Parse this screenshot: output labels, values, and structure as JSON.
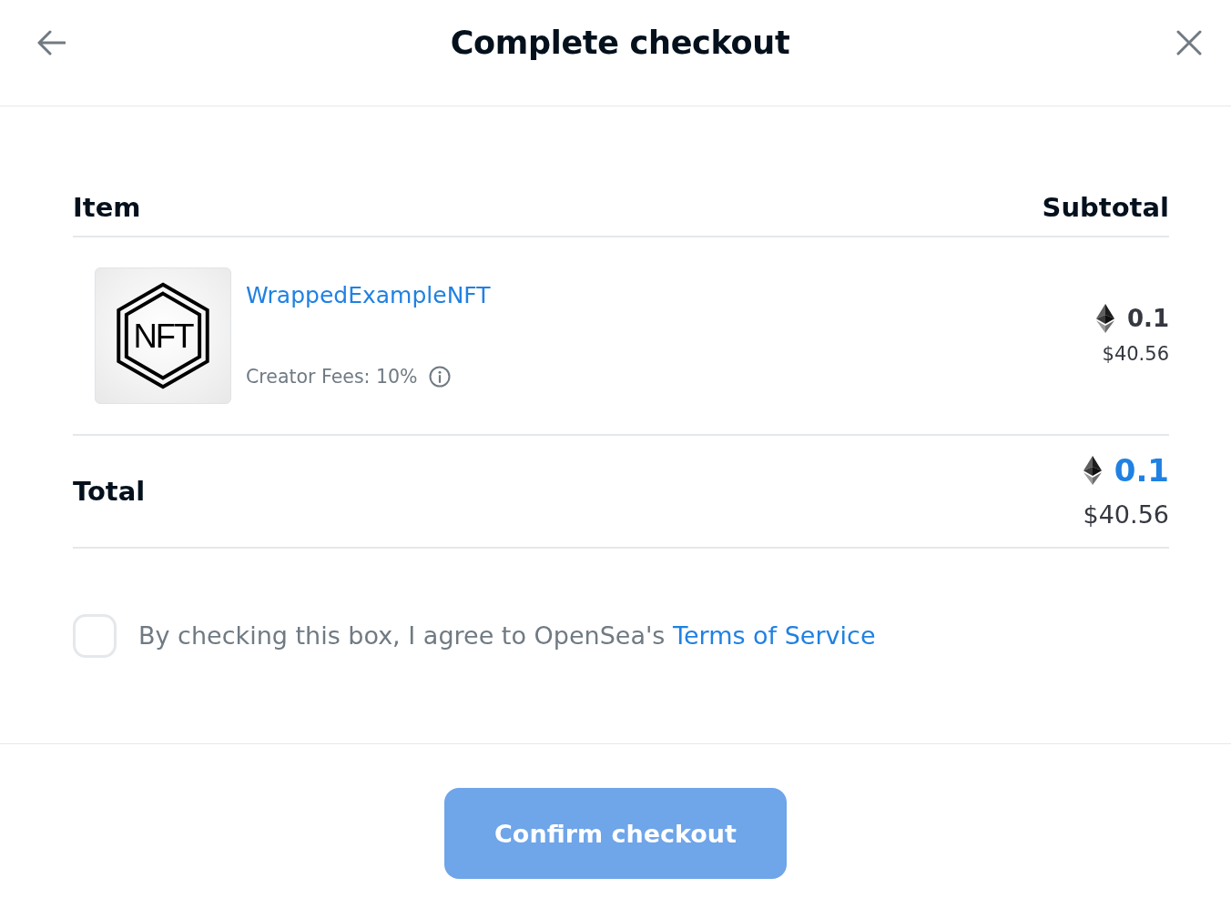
{
  "header": {
    "title": "Complete checkout"
  },
  "table": {
    "columns": [
      "Item",
      "Subtotal"
    ],
    "items": [
      {
        "thumbnail_text": "NFT",
        "name": "WrappedExampleNFT",
        "creator_fees": "Creator Fees: 10%",
        "price_eth": "0.1",
        "price_usd": "$40.56"
      }
    ]
  },
  "total": {
    "label": "Total",
    "eth": "0.1",
    "usd": "$40.56"
  },
  "agreement": {
    "checked": false,
    "text": "By checking this box, I agree to OpenSea's ",
    "link": "Terms of Service"
  },
  "confirm_button": {
    "label": "Confirm checkout",
    "disabled": true
  }
}
